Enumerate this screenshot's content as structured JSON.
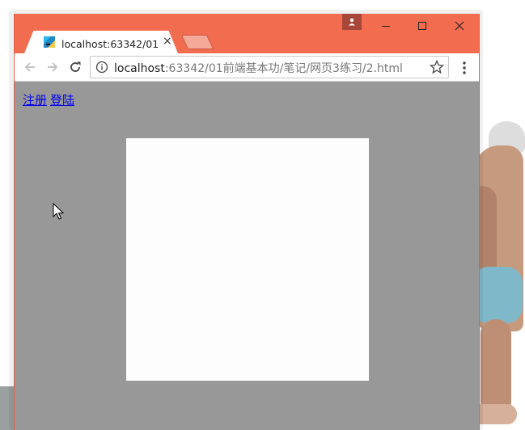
{
  "window": {
    "tab_title": "localhost:63342/01前端",
    "tab_close_glyph": "×",
    "controls": {
      "minimize_icon": "minimize-icon",
      "maximize_icon": "maximize-icon",
      "close_icon": "close-icon"
    }
  },
  "toolbar": {
    "url_host": "localhost",
    "url_path": ":63342/01前端基本功/笔记/网页3练习/2.html"
  },
  "page": {
    "links": [
      {
        "label": "注册"
      },
      {
        "label": "登陆"
      }
    ]
  },
  "colors": {
    "titlebar": "#f26c4f",
    "page_background": "#989898",
    "box": "#fdfdfd",
    "link": "#0000ee"
  }
}
